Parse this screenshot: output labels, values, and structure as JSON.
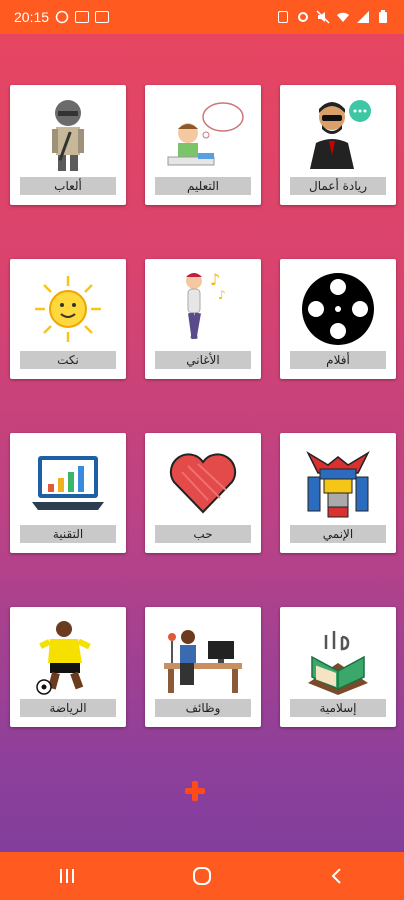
{
  "status_bar": {
    "time": "20:15",
    "left_icons": [
      "whatsapp-icon",
      "youtube-icon",
      "app-icon"
    ],
    "right_icons": [
      "alarm-icon",
      "settings-icon",
      "mute-icon",
      "wifi-icon",
      "signal-icon",
      "battery-icon"
    ]
  },
  "cards": [
    {
      "label": "ألعاب",
      "icon": "soldier-icon"
    },
    {
      "label": "التعليم",
      "icon": "student-thinking-icon"
    },
    {
      "label": "ريادة أعمال",
      "icon": "businessman-icon"
    },
    {
      "label": "نكت",
      "icon": "sun-icon"
    },
    {
      "label": "الأغاني",
      "icon": "singing-person-icon"
    },
    {
      "label": "أفلام",
      "icon": "film-reel-icon"
    },
    {
      "label": "التقنية",
      "icon": "laptop-chart-icon"
    },
    {
      "label": "حب",
      "icon": "heart-icon"
    },
    {
      "label": "الإنمي",
      "icon": "robot-icon"
    },
    {
      "label": "الرياضة",
      "icon": "football-player-icon"
    },
    {
      "label": "وظائف",
      "icon": "office-worker-icon"
    },
    {
      "label": "إسلامية",
      "icon": "quran-icon"
    }
  ],
  "add_button": {
    "icon": "plus-icon",
    "color": "#ff4a1a"
  },
  "nav": {
    "buttons": [
      "recent-apps-icon",
      "home-icon",
      "back-icon"
    ]
  },
  "colors": {
    "accent": "#ff5a1f",
    "background_top": "#e8465f",
    "background_bottom": "#7c3d9c"
  }
}
